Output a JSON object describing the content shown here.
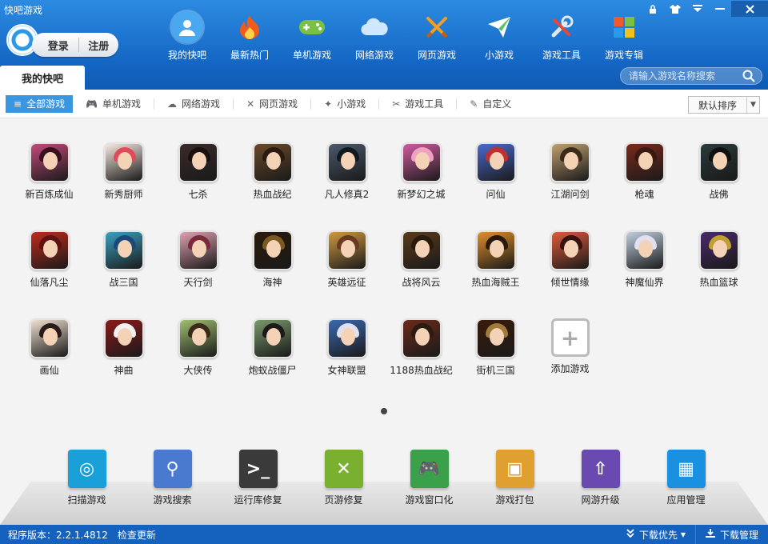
{
  "app_title": "快吧游戏",
  "auth": {
    "login": "登录",
    "register": "注册"
  },
  "nav": [
    {
      "label": "我的快吧",
      "icon": "user-icon"
    },
    {
      "label": "最新热门",
      "icon": "flame-icon"
    },
    {
      "label": "单机游戏",
      "icon": "gamepad-icon"
    },
    {
      "label": "网络游戏",
      "icon": "cloud-icon"
    },
    {
      "label": "网页游戏",
      "icon": "crossed-swords-icon"
    },
    {
      "label": "小游戏",
      "icon": "paper-plane-icon"
    },
    {
      "label": "游戏工具",
      "icon": "tools-icon"
    },
    {
      "label": "游戏专辑",
      "icon": "tiles-icon"
    }
  ],
  "tab_mine": "我的快吧",
  "search": {
    "placeholder": "请输入游戏名称搜索"
  },
  "filters": [
    {
      "label": "全部游戏",
      "icon": "≡",
      "active": true
    },
    {
      "label": "单机游戏",
      "icon": "🎮"
    },
    {
      "label": "网络游戏",
      "icon": "☁"
    },
    {
      "label": "网页游戏",
      "icon": "✕"
    },
    {
      "label": "小游戏",
      "icon": "✦"
    },
    {
      "label": "游戏工具",
      "icon": "✂"
    },
    {
      "label": "自定义",
      "icon": "✎"
    }
  ],
  "sort": {
    "label": "默认排序"
  },
  "games": [
    {
      "name": "新百炼成仙",
      "bg": "#c44a7a",
      "hair": "#3a1020"
    },
    {
      "name": "新秀厨师",
      "bg": "#f7e9e0",
      "hair": "#e04a5a"
    },
    {
      "name": "七杀",
      "bg": "#3a2a2a",
      "hair": "#1a0e0e"
    },
    {
      "name": "热血战纪",
      "bg": "#6a4a2a",
      "hair": "#2a1a10"
    },
    {
      "name": "凡人修真2",
      "bg": "#4a5a6a",
      "hair": "#101820"
    },
    {
      "name": "新梦幻之城",
      "bg": "#d05aa0",
      "hair": "#f0a0c0"
    },
    {
      "name": "问仙",
      "bg": "#4a6ad0",
      "hair": "#c03030"
    },
    {
      "name": "江湖问剑",
      "bg": "#c0a070",
      "hair": "#3a2a1a"
    },
    {
      "name": "枪魂",
      "bg": "#7a2a1a",
      "hair": "#3a1a10"
    },
    {
      "name": "战佛",
      "bg": "#2a3a3a",
      "hair": "#101010"
    },
    {
      "name": "仙落凡尘",
      "bg": "#c02a1a",
      "hair": "#601010"
    },
    {
      "name": "战三国",
      "bg": "#3aa0c0",
      "hair": "#1a4a7a"
    },
    {
      "name": "天行剑",
      "bg": "#e0a0b0",
      "hair": "#7a2a3a"
    },
    {
      "name": "海神",
      "bg": "#2a1a0a",
      "hair": "#7a5a20"
    },
    {
      "name": "英雄远征",
      "bg": "#d09a40",
      "hair": "#6a3a20"
    },
    {
      "name": "战将风云",
      "bg": "#5a3a1a",
      "hair": "#2a1a0a"
    },
    {
      "name": "热血海贼王",
      "bg": "#e0902a",
      "hair": "#2a1a0a"
    },
    {
      "name": "倾世情缘",
      "bg": "#e05a3a",
      "hair": "#3a1010"
    },
    {
      "name": "神魔仙界",
      "bg": "#c0d0e0",
      "hair": "#e0e0f0"
    },
    {
      "name": "热血篮球",
      "bg": "#4a2a6a",
      "hair": "#c0a030"
    },
    {
      "name": "画仙",
      "bg": "#f0e0d0",
      "hair": "#2a1a1a"
    },
    {
      "name": "神曲",
      "bg": "#8a1a1a",
      "hair": "#f0f0f0"
    },
    {
      "name": "大侠传",
      "bg": "#a0c070",
      "hair": "#3a2a1a"
    },
    {
      "name": "炮蚁战僵尸",
      "bg": "#7a9a6a",
      "hair": "#1a1a1a"
    },
    {
      "name": "女神联盟",
      "bg": "#3a6ab0",
      "hair": "#e0e0f0"
    },
    {
      "name": "1188热血战纪",
      "bg": "#6a2a1a",
      "hair": "#2a1a10"
    },
    {
      "name": "街机三国",
      "bg": "#3a1a0a",
      "hair": "#a07a3a"
    }
  ],
  "add_game": {
    "label": "添加游戏",
    "symbol": "+"
  },
  "tools": [
    {
      "label": "扫描游戏",
      "color": "#1aa0d8",
      "glyph": "◎",
      "icon": "scan-icon"
    },
    {
      "label": "游戏搜索",
      "color": "#4a7ad0",
      "glyph": "⚲",
      "icon": "magnifier-icon"
    },
    {
      "label": "运行库修复",
      "color": "#3a3a3a",
      "glyph": ">_",
      "icon": "terminal-wrench-icon"
    },
    {
      "label": "页游修复",
      "color": "#7ab030",
      "glyph": "✕",
      "icon": "crossed-swords-icon"
    },
    {
      "label": "游戏窗口化",
      "color": "#3aa04a",
      "glyph": "🎮",
      "icon": "gamepad-window-icon"
    },
    {
      "label": "游戏打包",
      "color": "#e0a030",
      "glyph": "▣",
      "icon": "box-icon"
    },
    {
      "label": "网游升级",
      "color": "#6a4ab0",
      "glyph": "⇧",
      "icon": "globe-upgrade-icon"
    },
    {
      "label": "应用管理",
      "color": "#1a90e0",
      "glyph": "▦",
      "icon": "apps-grid-icon"
    }
  ],
  "status": {
    "version": "程序版本：2.2.1.4812",
    "check_update": "检查更新",
    "download_priority": "下载优先",
    "download_manager": "下载管理"
  },
  "colors": {
    "header": "#1466c4",
    "active_filter": "#3a96e0",
    "status_bar": "#1562be"
  }
}
